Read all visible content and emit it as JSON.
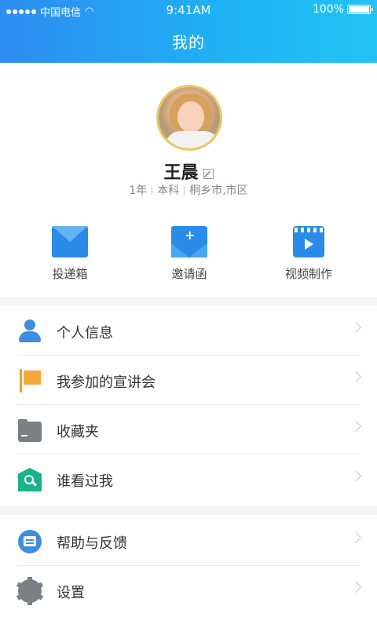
{
  "status_bar": {
    "carrier": "中国电信",
    "time": "9:41AM",
    "battery": "100%"
  },
  "header": {
    "title": "我的"
  },
  "profile": {
    "name": "王晨",
    "year": "1年",
    "degree": "本科",
    "location": "桐乡市,市区"
  },
  "shortcuts": [
    {
      "label": "投递箱",
      "icon": "envelope-icon"
    },
    {
      "label": "邀请函",
      "icon": "invitation-icon"
    },
    {
      "label": "视频制作",
      "icon": "video-icon"
    }
  ],
  "menu": [
    {
      "label": "个人信息",
      "icon": "person-icon"
    },
    {
      "label": "我参加的宣讲会",
      "icon": "flag-icon"
    },
    {
      "label": "收藏夹",
      "icon": "folder-icon"
    },
    {
      "label": "谁看过我",
      "icon": "viewer-search-icon"
    }
  ],
  "menu2": [
    {
      "label": "帮助与反馈",
      "icon": "help-chat-icon"
    },
    {
      "label": "设置",
      "icon": "gear-icon"
    }
  ],
  "colors": {
    "header_gradient_start": "#2d8cf0",
    "header_gradient_end": "#22c3f7",
    "accent_blue": "#2a8be8",
    "flag_orange": "#f7a63a",
    "viewer_green": "#1bb28a"
  }
}
